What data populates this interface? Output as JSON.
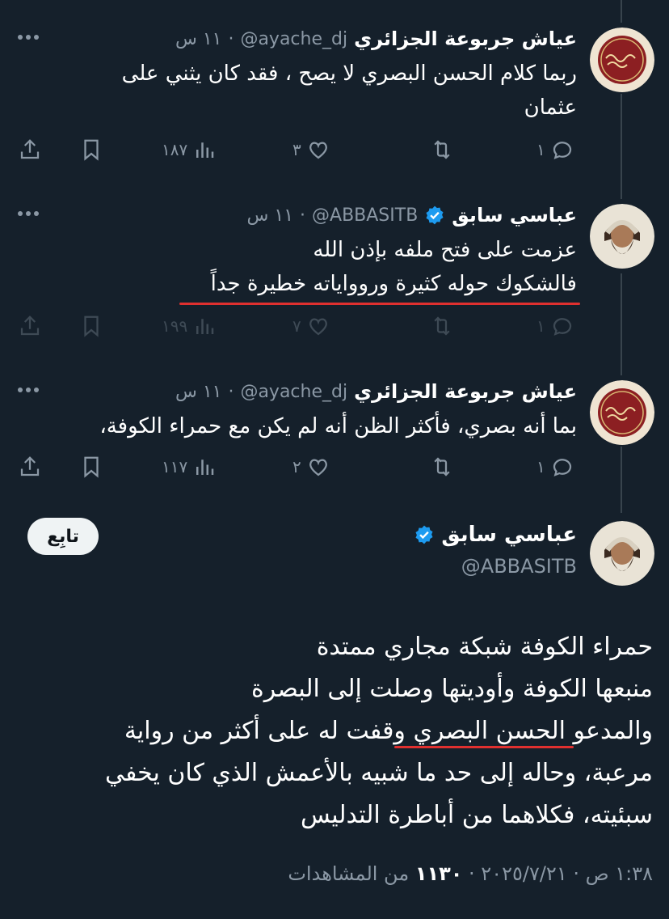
{
  "tweets": [
    {
      "name": "عياش جربوعة الجزائري",
      "handle": "@ayache_dj",
      "separator": "·",
      "time": "١١ س",
      "verified": false,
      "text_lines": [
        "ربما كلام الحسن البصري لا يصح ،  فقد كان يثني على",
        "عثمان"
      ],
      "actions": {
        "replies": "١",
        "retweets": "",
        "likes": "٣",
        "views": "١٨٧"
      }
    },
    {
      "name": "عباسي سابق",
      "handle": "@ABBASITB",
      "separator": "·",
      "time": "١١ س",
      "verified": true,
      "text_lines": [
        "عزمت على فتح ملفه بإذن الله",
        "فالشكوك حوله كثيرة وروواياته خطيرة جداً"
      ],
      "actions": {
        "replies": "١",
        "retweets": "",
        "likes": "٧",
        "views": "١٩٩"
      }
    },
    {
      "name": "عياش جربوعة الجزائري",
      "handle": "@ayache_dj",
      "separator": "·",
      "time": "١١ س",
      "verified": false,
      "text_lines": [
        "بما أنه بصري،  فأكثر الظن أنه لم يكن مع حمراء الكوفة،"
      ],
      "actions": {
        "replies": "١",
        "retweets": "",
        "likes": "٢",
        "views": "١١٧"
      }
    }
  ],
  "main_tweet": {
    "name": "عباسي سابق",
    "handle": "@ABBASITB",
    "follow_label": "تابِع",
    "text_lines": [
      "حمراء الكوفة شبكة مجاري ممتدة",
      "منبعها الكوفة وأوديتها وصلت إلى البصرة",
      "والمدعو الحسن البصري وقفت له على أكثر من رواية",
      "مرعبة، وحاله إلى حد ما شبيه بالأعمش الذي كان يخفي",
      "سبئيته، فكلاهما من أباطرة التدليس"
    ],
    "footer_datetime": "١:٣٨ ص · ٢٠٢٥/٧/٢١ · ",
    "footer_views": "١١٣٠",
    "footer_views_label": " من المشاهدات"
  },
  "colors": {
    "background": "#15202b",
    "muted": "#8b98a5",
    "verified": "#1d9bf0",
    "underline": "#e0302f"
  },
  "icons": [
    "more-icon",
    "reply-icon",
    "retweet-icon",
    "like-icon",
    "views-icon",
    "bookmark-icon",
    "share-icon",
    "verified-icon"
  ]
}
